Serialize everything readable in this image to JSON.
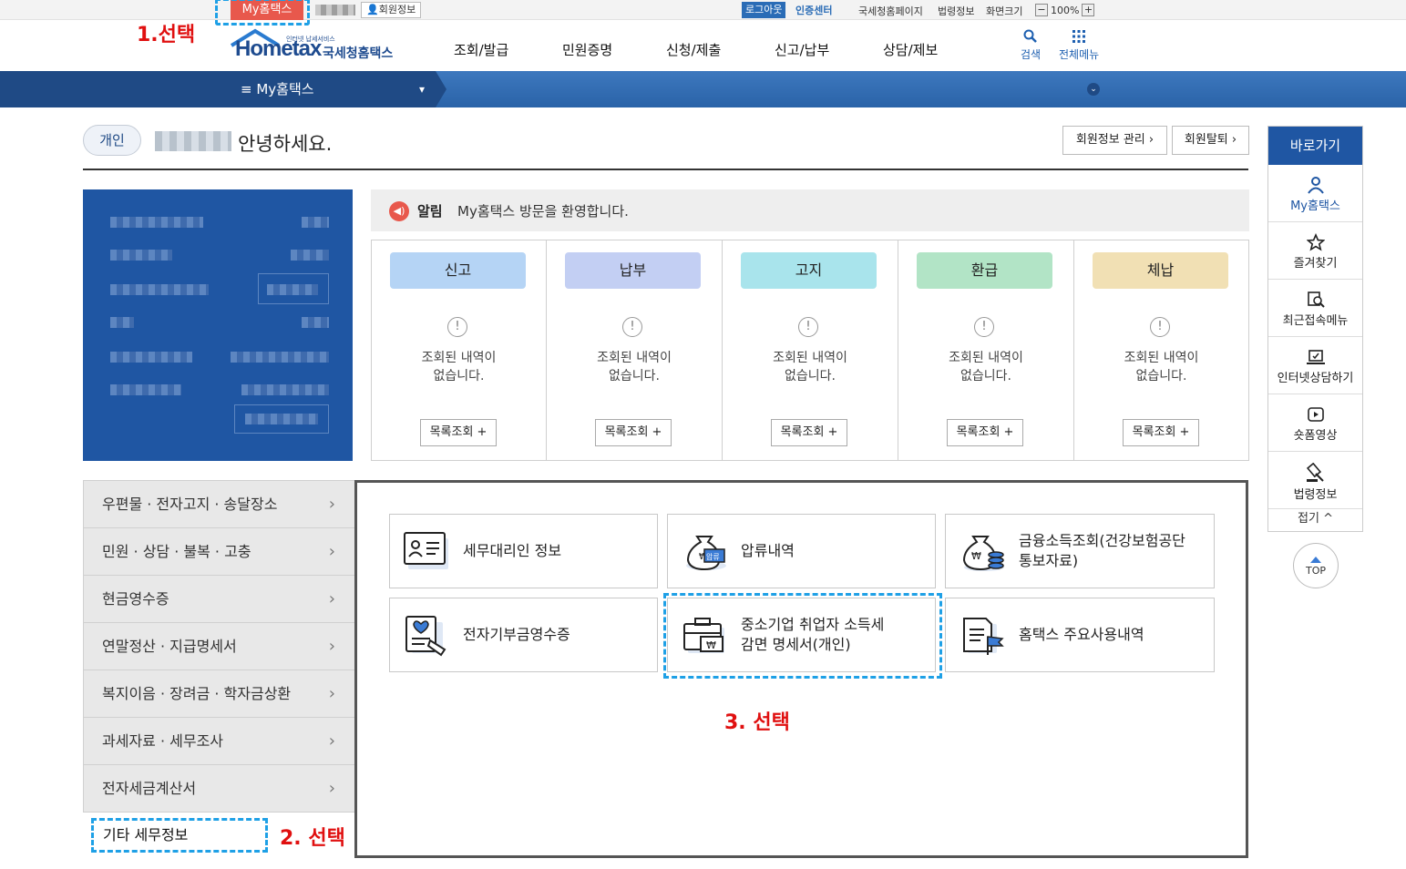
{
  "topbar": {
    "my_hometax": "My홈택스",
    "member_info": "회원정보",
    "logout": "로그아웃",
    "cert_center": "인증센터",
    "nts_page": "국세청홈페이지",
    "law_info": "법령정보",
    "screen_size": "화면크기",
    "zoom_minus": "−",
    "zoom_value": "100%",
    "zoom_plus": "+"
  },
  "annotations": {
    "step1": "1.선택",
    "step2": "2. 선택",
    "step3": "3. 선택"
  },
  "header": {
    "logo_main": "Hometax",
    "logo_tiny": "인터넷 납세서비스",
    "logo_sub": "국세청홈택스",
    "nav": [
      "조회/발급",
      "민원증명",
      "신청/제출",
      "신고/납부",
      "상담/제보"
    ],
    "search_label": "검색",
    "allmenu_label": "전체메뉴"
  },
  "navbar": {
    "current": "≡  My홈택스",
    "dropdown_caret": "▾",
    "expand_icon": "⌄"
  },
  "greeting": {
    "type": "개인",
    "text": "안녕하세요.",
    "manage_btn": "회원정보 관리 ›",
    "withdraw_btn": "회원탈퇴 ›"
  },
  "notice": {
    "label": "알림",
    "text": "My홈택스 방문을 환영합니다."
  },
  "cards": [
    {
      "title": "신고",
      "color": "#b5d4f5",
      "msg1": "조회된 내역이",
      "msg2": "없습니다.",
      "btn": "목록조회 +"
    },
    {
      "title": "납부",
      "color": "#c3cff3",
      "msg1": "조회된 내역이",
      "msg2": "없습니다.",
      "btn": "목록조회 +"
    },
    {
      "title": "고지",
      "color": "#a9e4ec",
      "msg1": "조회된 내역이",
      "msg2": "없습니다.",
      "btn": "목록조회 +"
    },
    {
      "title": "환급",
      "color": "#b2e4c6",
      "msg1": "조회된 내역이",
      "msg2": "없습니다.",
      "btn": "목록조회 +"
    },
    {
      "title": "체납",
      "color": "#f1e0b4",
      "msg1": "조회된 내역이",
      "msg2": "없습니다.",
      "btn": "목록조회 +"
    }
  ],
  "leftmenu": {
    "items": [
      "우편물 · 전자고지 · 송달장소",
      "민원 · 상담 · 불복 · 고충",
      "현금영수증",
      "연말정산 · 지급명세서",
      "복지이음 · 장려금 · 학자금상환",
      "과세자료 · 세무조사",
      "전자세금계산서"
    ],
    "arrow": "›",
    "selected": "기타 세무정보"
  },
  "tiles": [
    {
      "label": "세무대리인 정보",
      "icon": "tax-agent-icon"
    },
    {
      "label": "압류내역",
      "icon": "seizure-bag-icon",
      "icon_text": "압류"
    },
    {
      "label1": "금융소득조회(건강보험공단",
      "label2": "통보자료)",
      "icon": "money-bag-icon"
    },
    {
      "label": "전자기부금영수증",
      "icon": "donation-receipt-icon"
    },
    {
      "label1": "중소기업 취업자 소득세",
      "label2": "감면 명세서(개인)",
      "icon": "briefcase-money-icon"
    },
    {
      "label": "홈택스 주요사용내역",
      "icon": "usage-history-icon"
    }
  ],
  "quick": {
    "title": "바로가기",
    "items": [
      "My홈택스",
      "즐겨찾기",
      "최근접속메뉴",
      "인터넷상담하기",
      "숏폼영상",
      "법령정보"
    ],
    "fold": "접기 ^",
    "top": "TOP"
  }
}
